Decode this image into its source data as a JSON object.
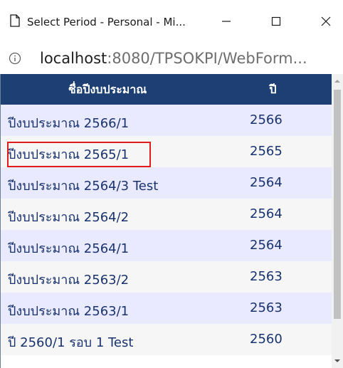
{
  "window": {
    "title": "Select Period - Personal - Mi...",
    "page_icon": "page-icon",
    "minimize_icon": "minimize-icon",
    "maximize_icon": "maximize-icon",
    "close_icon": "close-icon"
  },
  "address": {
    "info_icon": "info-icon",
    "host": "localhost",
    "path": ":8080/TPSOKPI/WebForm..."
  },
  "table": {
    "headers": [
      "ชื่อปีงบประมาณ",
      "ปี"
    ],
    "rows": [
      {
        "name": "ปีงบประมาณ 2566/1",
        "year": "2566"
      },
      {
        "name": "ปีงบประมาณ 2565/1",
        "year": "2565"
      },
      {
        "name": "ปีงบประมาณ 2564/3 Test",
        "year": "2564"
      },
      {
        "name": "ปีงบประมาณ 2564/2",
        "year": "2564"
      },
      {
        "name": "ปีงบประมาณ 2564/1",
        "year": "2564"
      },
      {
        "name": "ปีงบประมาณ 2563/2",
        "year": "2563"
      },
      {
        "name": "ปีงบประมาณ 2563/1",
        "year": "2563"
      },
      {
        "name": "ปี 2560/1 รอบ 1 Test",
        "year": "2560"
      }
    ],
    "highlighted_row": "ปีงบประมาณ 2565/1"
  },
  "colors": {
    "header_bg": "#1d3f74",
    "row_odd": "#e9e9ff",
    "row_even": "#f6f6f6",
    "text": "#1a3370",
    "highlight_border": "#e21b1b"
  }
}
